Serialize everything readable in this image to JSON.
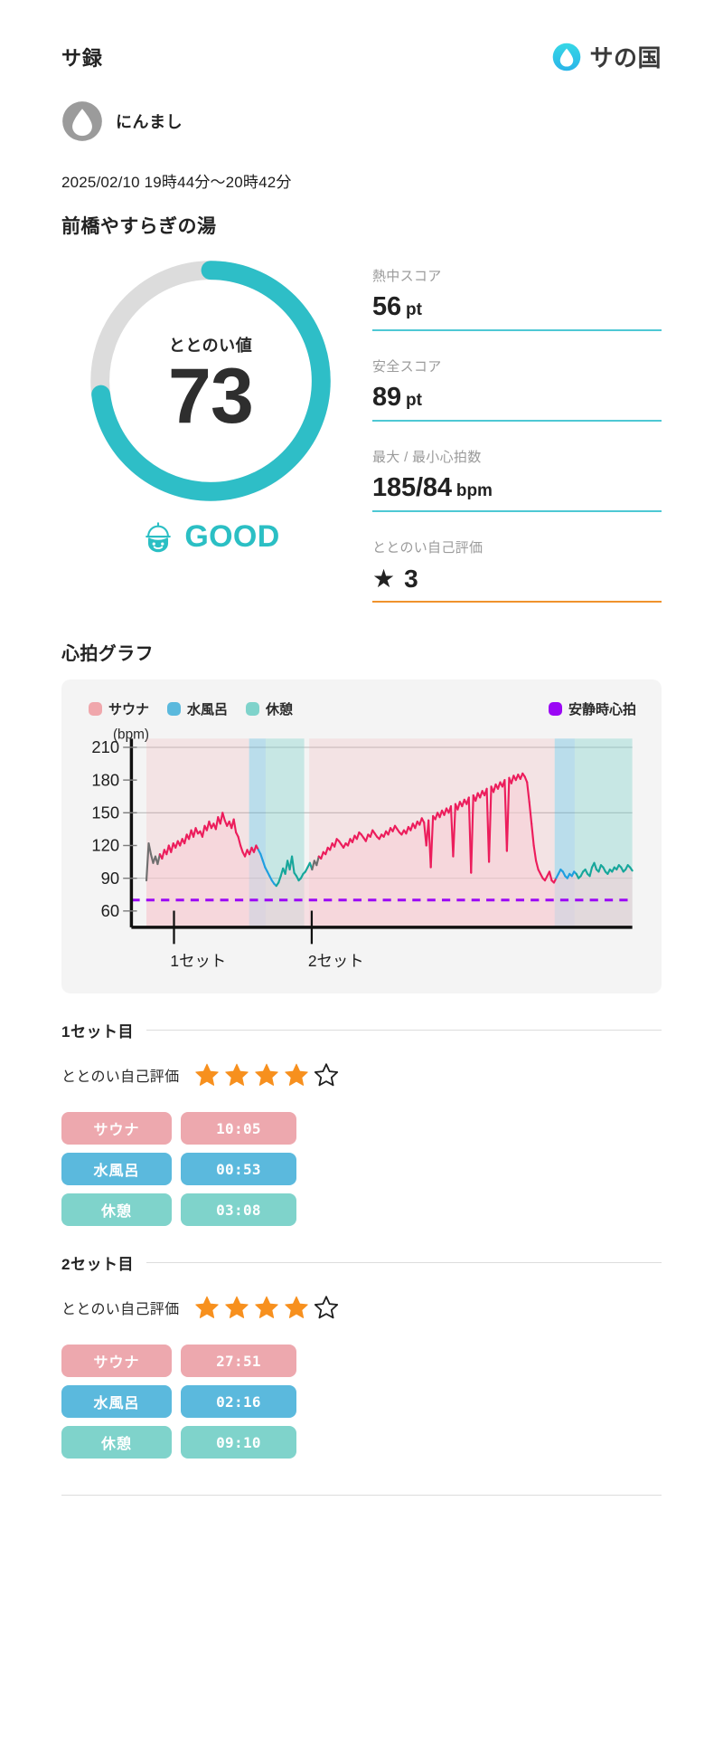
{
  "header": {
    "app_title": "サ録",
    "brand_name": "サの国",
    "brand_icon": "water-drop-icon",
    "brand_color": "#2ec9dd"
  },
  "user": {
    "avatar_icon": "water-drop-avatar",
    "name": "にんまし"
  },
  "session": {
    "datetime": "2025/02/10 19時44分〜20時42分",
    "venue": "前橋やすらぎの湯"
  },
  "score_ring": {
    "label": "ととのい値",
    "value": "73",
    "percent": 73,
    "track_color": "#dcdcdc",
    "fill_color": "#2ebec7"
  },
  "verdict": {
    "icon": "sauna-face-good-icon",
    "text": "GOOD",
    "color": "#2bbfc4"
  },
  "stats": [
    {
      "label": "熱中スコア",
      "value": "56",
      "unit": "pt",
      "rule_color": "#4ec8d4"
    },
    {
      "label": "安全スコア",
      "value": "89",
      "unit": "pt",
      "rule_color": "#4ec8d4"
    },
    {
      "label": "最大 / 最小心拍数",
      "value": "185/84",
      "unit": "bpm",
      "rule_color": "#4ec8d4"
    },
    {
      "label": "ととのい自己評価",
      "value": "★ 3",
      "unit": "",
      "rule_color": "#f0922c"
    }
  ],
  "chart": {
    "title": "心拍グラフ",
    "legend": [
      {
        "label": "サウナ",
        "color": "#f0a7ac"
      },
      {
        "label": "水風呂",
        "color": "#5bb9dd"
      },
      {
        "label": "休憩",
        "color": "#7fd3cb"
      },
      {
        "label": "安静時心拍",
        "color": "#9b07f5"
      }
    ]
  },
  "chart_data": {
    "type": "line",
    "title": "心拍グラフ",
    "xlabel": "",
    "ylabel": "(bpm)",
    "ylim": [
      45,
      218
    ],
    "yticks": [
      60,
      90,
      120,
      150,
      180,
      210
    ],
    "gridlines": [
      90,
      150,
      210
    ],
    "grid": true,
    "legend_position": "top",
    "xticks": [
      {
        "label": "1セット",
        "x_frac": 0.085
      },
      {
        "label": "2セット",
        "x_frac": 0.36
      }
    ],
    "resting_hr": 70,
    "resting_hr_color": "#9b07f5",
    "resting_hr_style": "dashed",
    "phases": [
      {
        "type": "サウナ",
        "color": "#f0a7ac",
        "x_start": 0.03,
        "x_end": 0.235
      },
      {
        "type": "水風呂",
        "color": "#5bb9dd",
        "x_start": 0.235,
        "x_end": 0.268
      },
      {
        "type": "休憩",
        "color": "#7fd3cb",
        "x_start": 0.268,
        "x_end": 0.345
      },
      {
        "type": "サウナ",
        "color": "#f0a7ac",
        "x_start": 0.355,
        "x_end": 0.845
      },
      {
        "type": "水風呂",
        "color": "#5bb9dd",
        "x_start": 0.845,
        "x_end": 0.885
      },
      {
        "type": "休憩",
        "color": "#7fd3cb",
        "x_start": 0.885,
        "x_end": 1.0
      }
    ],
    "series": [
      {
        "name": "心拍数",
        "line_colors": {
          "サウナ": "#ec1d5c",
          "水風呂": "#1f9fe0",
          "休憩": "#16a79b",
          "移動": "#6f6f6f"
        },
        "values": [
          88,
          122,
          112,
          104,
          110,
          103,
          112,
          108,
          116,
          112,
          120,
          114,
          122,
          118,
          124,
          120,
          126,
          122,
          130,
          126,
          134,
          128,
          136,
          131,
          133,
          128,
          138,
          134,
          142,
          136,
          140,
          135,
          146,
          140,
          150,
          143,
          138,
          142,
          136,
          144,
          132,
          128,
          120,
          114,
          110,
          116,
          112,
          118,
          114,
          120,
          116,
          112,
          106,
          100,
          96,
          92,
          88,
          85,
          83,
          86,
          92,
          99,
          94,
          106,
          98,
          110,
          95,
          92,
          88,
          90,
          94,
          96,
          100,
          104,
          98,
          106,
          102,
          110,
          108,
          114,
          112,
          118,
          116,
          122,
          119,
          126,
          124,
          121,
          118,
          122,
          120,
          126,
          123,
          129,
          126,
          132,
          130,
          127,
          124,
          130,
          128,
          134,
          131,
          128,
          126,
          130,
          128,
          133,
          130,
          136,
          133,
          138,
          135,
          132,
          130,
          134,
          131,
          137,
          134,
          140,
          136,
          142,
          139,
          145,
          141,
          120,
          143,
          100,
          147,
          144,
          150,
          146,
          152,
          148,
          154,
          150,
          156,
          110,
          158,
          153,
          160,
          156,
          162,
          158,
          164,
          95,
          166,
          161,
          168,
          164,
          170,
          166,
          172,
          105,
          174,
          169,
          176,
          172,
          178,
          174,
          180,
          115,
          182,
          177,
          184,
          180,
          185,
          181,
          186,
          183,
          178,
          160,
          140,
          120,
          106,
          98,
          94,
          90,
          88,
          92,
          96,
          88,
          86,
          90,
          94,
          98,
          96,
          92,
          90,
          94,
          92,
          96,
          94,
          90,
          92,
          96,
          98,
          94,
          92,
          100,
          104,
          98,
          96,
          102,
          100,
          96,
          94,
          98,
          96,
          100,
          98,
          102,
          100,
          96,
          98,
          102,
          100,
          97
        ]
      }
    ]
  },
  "sets": [
    {
      "title": "1セット目",
      "rating_label": "ととのい自己評価",
      "rating": 4,
      "rating_max": 5,
      "rows": [
        {
          "name": "サウナ",
          "time": "10:05",
          "color": "#eda8ae"
        },
        {
          "name": "水風呂",
          "time": "00:53",
          "color": "#5bb9dd"
        },
        {
          "name": "休憩",
          "time": "03:08",
          "color": "#7fd3cb"
        }
      ]
    },
    {
      "title": "2セット目",
      "rating_label": "ととのい自己評価",
      "rating": 4,
      "rating_max": 5,
      "rows": [
        {
          "name": "サウナ",
          "time": "27:51",
          "color": "#eda8ae"
        },
        {
          "name": "水風呂",
          "time": "02:16",
          "color": "#5bb9dd"
        },
        {
          "name": "休憩",
          "time": "09:10",
          "color": "#7fd3cb"
        }
      ]
    }
  ]
}
